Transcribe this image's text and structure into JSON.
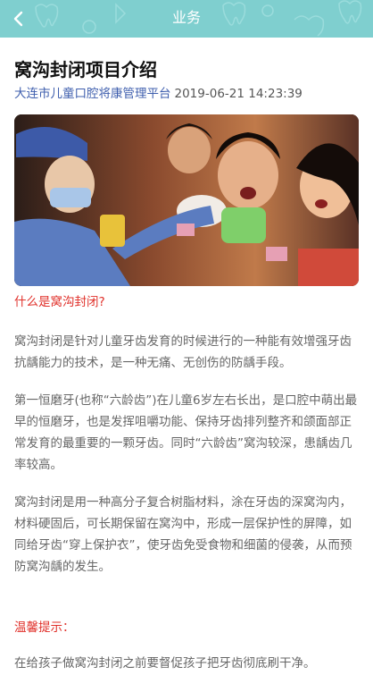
{
  "nav": {
    "title": "业务",
    "back_icon": "chevron-left-icon",
    "background": "#7fcfcf"
  },
  "article": {
    "title": "窝沟封闭项目介绍",
    "source": "大连市儿童口腔将康管理平台",
    "date": "2019-06-21 14:23:39",
    "section_label": "什么是窝沟封闭?",
    "paragraphs": [
      "窝沟封闭是针对儿童牙齿发育的时候进行的一种能有效增强牙齿抗龋能力的技术，是一种无痛、无创伤的防龋手段。",
      "第一恒磨牙(也称“六龄齿”)在儿童6岁左右长出，是口腔中萌出最早的恒磨牙，也是发挥咀嚼功能、保持牙齿排列整齐和颌面部正常发育的最重要的一颗牙齿。同时“六龄齿”窝沟较深，患龋齿几率较高。",
      "窝沟封闭是用一种高分子复合树脂材料，涂在牙齿的深窝沟内，材料硬固后，可长期保留在窝沟中，形成一层保护性的屏障，如同给牙齿“穿上保护衣”，使牙齿免受食物和细菌的侵袭，从而预防窝沟龋的发生。"
    ],
    "tip_label": "温馨提示：",
    "tip_text": "在给孩子做窝沟封闭之前要督促孩子把牙齿彻底刷干净。"
  },
  "colors": {
    "accent_red": "#e0302a",
    "source_blue": "#3f5fae",
    "body_text": "#666666"
  }
}
